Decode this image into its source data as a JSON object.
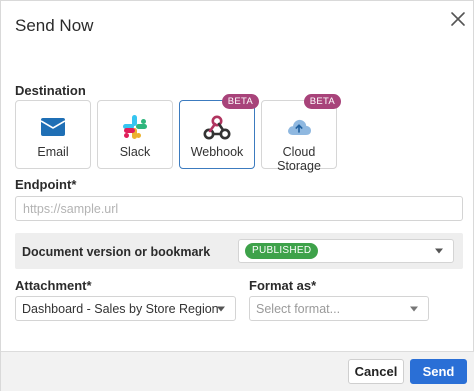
{
  "dialog": {
    "title": "Send Now",
    "close_icon": "close-icon"
  },
  "destination": {
    "label": "Destination",
    "options": [
      {
        "label": "Email",
        "icon": "email-icon",
        "selected": false,
        "badge": ""
      },
      {
        "label": "Slack",
        "icon": "slack-icon",
        "selected": false,
        "badge": ""
      },
      {
        "label": "Webhook",
        "icon": "webhook-icon",
        "selected": true,
        "badge": "BETA"
      },
      {
        "label": "Cloud Storage",
        "icon": "cloud-upload-icon",
        "selected": false,
        "badge": "BETA"
      }
    ]
  },
  "endpoint": {
    "label": "Endpoint*",
    "placeholder": "https://sample.url",
    "value": ""
  },
  "document_version": {
    "label": "Document version or bookmark",
    "selected": "PUBLISHED"
  },
  "attachment": {
    "label": "Attachment*",
    "selected": "Dashboard - Sales by Store Region"
  },
  "format": {
    "label": "Format as*",
    "placeholder": "Select format..."
  },
  "footer": {
    "cancel_label": "Cancel",
    "send_label": "Send"
  },
  "colors": {
    "accent": "#2a6fd6",
    "selected_border": "#3c7bbf",
    "beta_badge": "#a8437a",
    "published_pill": "#3ea24a"
  }
}
